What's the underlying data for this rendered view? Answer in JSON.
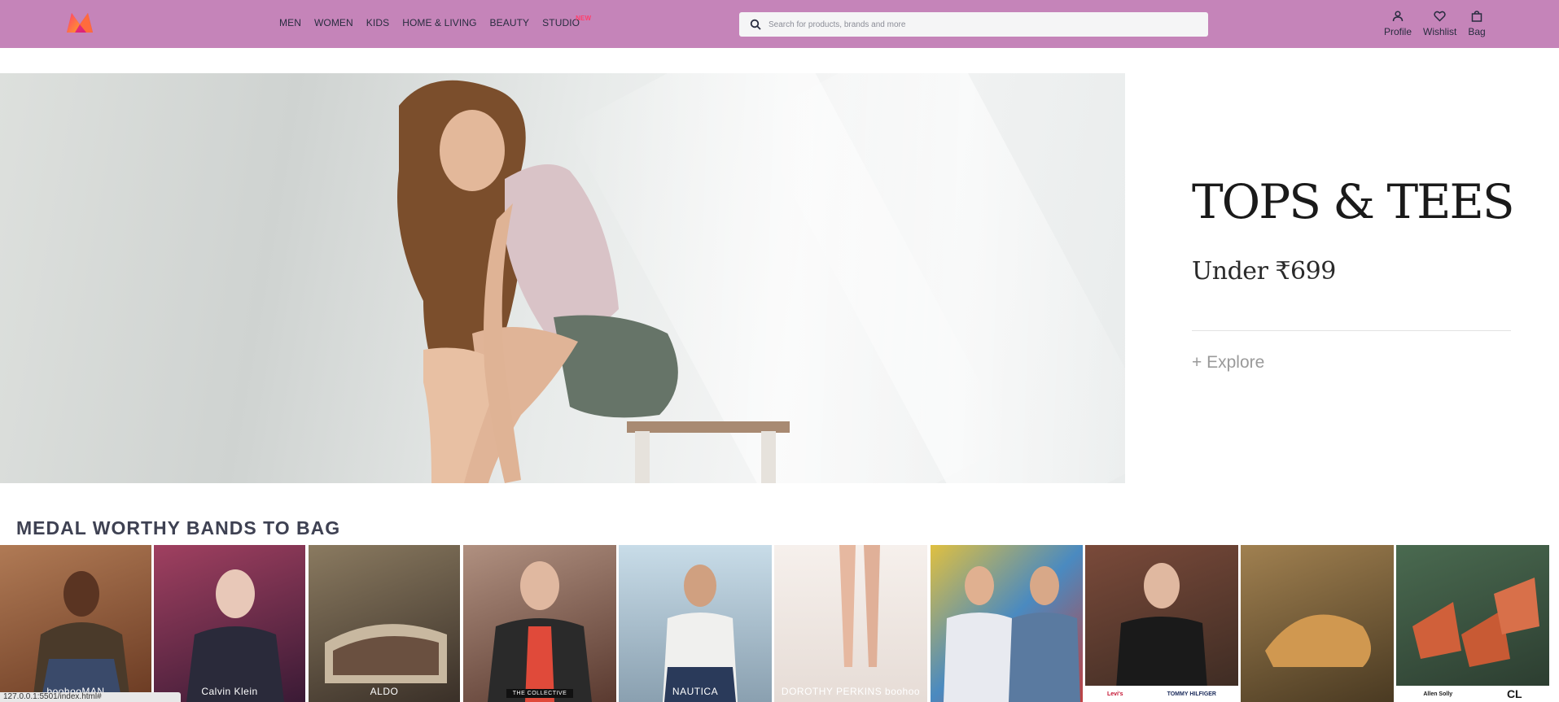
{
  "header": {
    "nav": [
      {
        "label": "MEN"
      },
      {
        "label": "WOMEN"
      },
      {
        "label": "KIDS"
      },
      {
        "label": "HOME & LIVING"
      },
      {
        "label": "BEAUTY"
      },
      {
        "label": "STUDIO",
        "badge": "NEW"
      }
    ],
    "search": {
      "placeholder": "Search for products, brands and more",
      "value": ""
    },
    "actions": {
      "profile": "Profile",
      "wishlist": "Wishlist",
      "bag": "Bag"
    }
  },
  "hero": {
    "title": "TOPS & TEES",
    "subtitle": "Under ₹699",
    "cta": "+ Explore"
  },
  "section": {
    "title": "MEDAL WORTHY BANDS TO BAG"
  },
  "brands": [
    {
      "label": "boohooMAN",
      "bg": "#8a5a3c"
    },
    {
      "label": "Calvin Klein",
      "bg": "#6a2a45"
    },
    {
      "label": "ALDO",
      "bg": "#4a4038"
    },
    {
      "label": "THE COLLECTIVE",
      "bg": "#5a3a30"
    },
    {
      "label": "NAUTICA",
      "bg": "#9ab5c8"
    },
    {
      "label": "DOROTHY PERKINS  boohoo",
      "bg": "#f0e6e0"
    },
    {
      "label": "",
      "bg": "#c0a050"
    },
    {
      "label": "Levi's",
      "bg": "#2a2a2a"
    },
    {
      "label": "",
      "bg": "#7a5a30"
    },
    {
      "label": "Allen Solly",
      "bg": "#3a5a40"
    }
  ],
  "brand_strip": {
    "item1": "Levi's",
    "item2": "TOMMY HILFIGER",
    "item3": "Allen Solly",
    "item4": "CL"
  },
  "status_bar": {
    "url": "127.0.0.1:5501/index.html#"
  },
  "colors": {
    "header_bg": "#c584b9",
    "accent": "#ff3f6c"
  }
}
